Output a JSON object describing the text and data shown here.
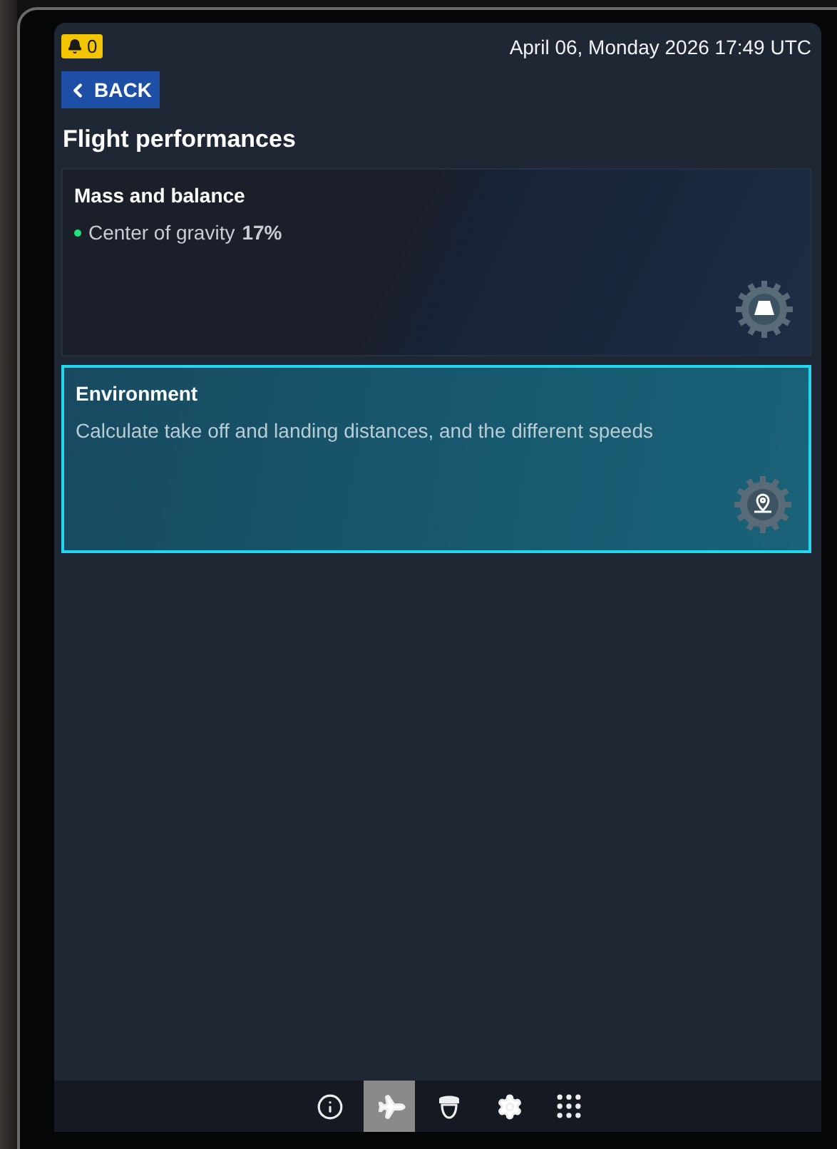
{
  "status_bar": {
    "alert_count": "0",
    "datetime": "April 06, Monday 2026 17:49 UTC"
  },
  "back_button": {
    "label": "BACK"
  },
  "title": "Flight performances",
  "cards": [
    {
      "title": "Mass and balance",
      "status": {
        "color": "#22e07a",
        "label": "Center of gravity",
        "value": "17%"
      },
      "kind": "weight",
      "selected": false
    },
    {
      "title": "Environment",
      "description": "Calculate take off and landing distances, and the different speeds",
      "kind": "location",
      "selected": true
    }
  ],
  "nav": [
    {
      "kind": "info",
      "selected": false
    },
    {
      "kind": "plane",
      "selected": true
    },
    {
      "kind": "pilot",
      "selected": false
    },
    {
      "kind": "settings",
      "selected": false
    },
    {
      "kind": "apps",
      "selected": false
    }
  ]
}
